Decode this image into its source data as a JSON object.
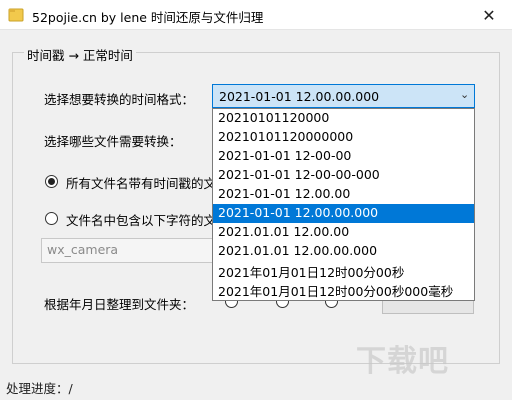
{
  "window": {
    "title": "52pojie.cn by lene 时间还原与文件归理",
    "close_glyph": "✕"
  },
  "group": {
    "legend": "时间戳 → 正常时间"
  },
  "form": {
    "format_label": "选择想要转换的时间格式：",
    "format_selected": "2021-01-01 12.00.00.000",
    "files_label": "选择哪些文件需要转换：",
    "radio_all_label": "所有文件名带有时间戳的文",
    "radio_contains_label": "文件名中包含以下字符的文",
    "filter_value": "wx_camera",
    "organize_label": "根据年月日整理到文件夹："
  },
  "dropdown": {
    "selected_index": 5,
    "options": [
      "20210101120000",
      "20210101120000000",
      "2021-01-01 12-00-00",
      "2021-01-01 12-00-00-000",
      "2021-01-01 12.00.00",
      "2021-01-01 12.00.00.000",
      "2021.01.01 12.00.00",
      "2021.01.01 12.00.00.000",
      "2021年01月01日12时00分00秒",
      "2021年01月01日12时00分00秒000毫秒"
    ]
  },
  "status": {
    "text": "处理进度：/"
  },
  "watermark": {
    "text": "下载吧"
  },
  "colors": {
    "accent": "#0078d7",
    "combo_bg": "#cce4f7"
  }
}
